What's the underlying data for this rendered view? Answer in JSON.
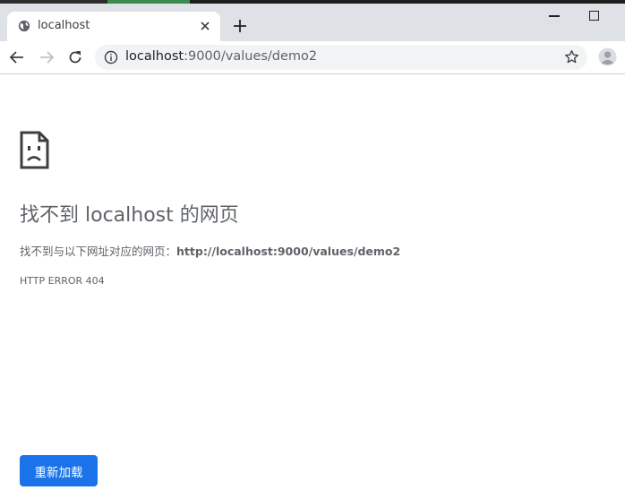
{
  "tab": {
    "title": "localhost",
    "new_tab_icon": "plus-icon",
    "close_icon": "close-icon"
  },
  "window_controls": [
    "minimize-icon",
    "maximize-icon"
  ],
  "toolbar": {
    "url_host": "localhost",
    "url_path": ":9000/values/demo2",
    "icons": [
      "back-arrow-icon",
      "forward-arrow-icon",
      "reload-icon",
      "info-icon",
      "star-icon",
      "profile-icon"
    ]
  },
  "error": {
    "heading": "找不到 localhost 的网页",
    "description_prefix": "找不到与以下网址对应的网页：",
    "description_url": "http://localhost:9000/values/demo2",
    "code": "HTTP ERROR 404",
    "reload_label": "重新加载"
  },
  "colors": {
    "accent": "#1a73e8",
    "tabstrip": "#dee1e6",
    "text_secondary": "#5f6368"
  }
}
